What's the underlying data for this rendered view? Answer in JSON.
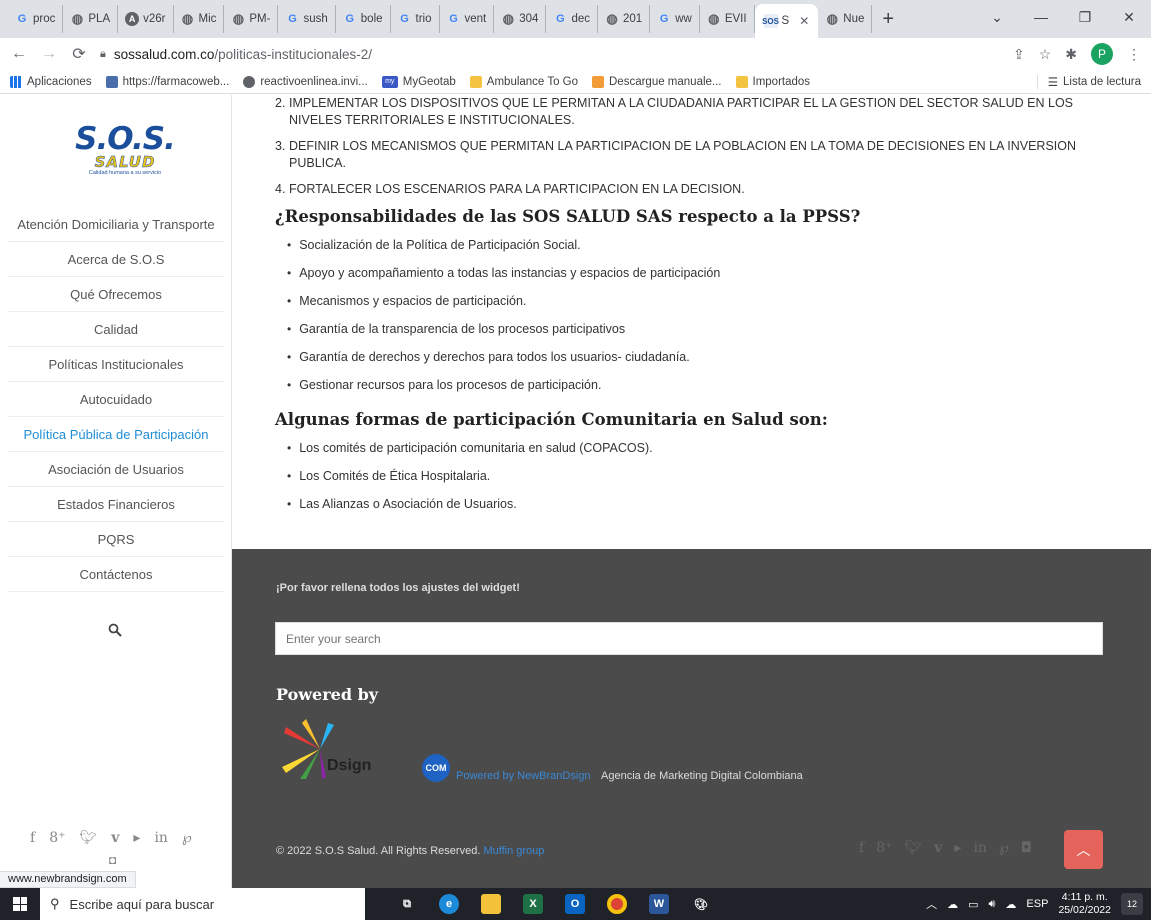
{
  "browser": {
    "tabs": [
      {
        "label": "proc",
        "favicon": "G"
      },
      {
        "label": "PLA",
        "favicon": "globe"
      },
      {
        "label": "v26r",
        "favicon": "A"
      },
      {
        "label": "Mic",
        "favicon": "globe"
      },
      {
        "label": "PM-",
        "favicon": "globe"
      },
      {
        "label": "sush",
        "favicon": "G"
      },
      {
        "label": "bole",
        "favicon": "G"
      },
      {
        "label": "trio",
        "favicon": "G"
      },
      {
        "label": "vent",
        "favicon": "G"
      },
      {
        "label": "304",
        "favicon": "globe"
      },
      {
        "label": "dec",
        "favicon": "G"
      },
      {
        "label": "201",
        "favicon": "globe"
      },
      {
        "label": "ww",
        "favicon": "G"
      },
      {
        "label": "EVII",
        "favicon": "globe"
      },
      {
        "label": "S",
        "favicon": "SOS",
        "active": true
      },
      {
        "label": "Nue",
        "favicon": "globe"
      }
    ],
    "url_host": "sossalud.com.co",
    "url_path": "/politicas-institucionales-2/",
    "profile_initial": "P",
    "bookmarks": [
      "Aplicaciones",
      "https://farmacoweb...",
      "reactivoenlinea.invi...",
      "MyGeotab",
      "Ambulance To Go",
      "Descargue manuale...",
      "Importados"
    ],
    "reading_list": "Lista de lectura",
    "status_url": "www.newbrandsign.com"
  },
  "sidebar": {
    "logo": {
      "line1": "S.O.S.",
      "line2": "SALUD",
      "tagline": "Calidad humana a su servicio"
    },
    "menu": [
      {
        "label": "Atención Domiciliaria y Transporte",
        "active": false
      },
      {
        "label": "Acerca de S.O.S",
        "active": false
      },
      {
        "label": "Qué Ofrecemos",
        "active": false
      },
      {
        "label": "Calidad",
        "active": false
      },
      {
        "label": "Políticas Institucionales",
        "active": false
      },
      {
        "label": "Autocuidado",
        "active": false
      },
      {
        "label": "Política Pública de Participación",
        "active": true
      },
      {
        "label": "Asociación de Usuarios",
        "active": false
      },
      {
        "label": "Estados Financieros",
        "active": false
      },
      {
        "label": "PQRS",
        "active": false
      },
      {
        "label": "Contáctenos",
        "active": false
      }
    ]
  },
  "content": {
    "ordered_items": [
      {
        "num": "2.",
        "text": "IMPLEMENTAR LOS DISPOSITIVOS QUE LE PERMITAN A LA CIUDADANIA PARTICIPAR EL LA GESTION DEL SECTOR SALUD EN LOS NIVELES TERRITORIALES E INSTITUCIONALES."
      },
      {
        "num": "3.",
        "text": "DEFINIR LOS MECANISMOS QUE PERMITAN LA PARTICIPACION DE LA POBLACION EN LA TOMA DE DECISIONES EN LA INVERSION PUBLICA."
      },
      {
        "num": "4.",
        "text": "FORTALECER LOS ESCENARIOS PARA LA PARTICIPACION EN LA DECISION."
      }
    ],
    "heading1": "¿Responsabilidades de las SOS SALUD SAS respecto a la PPSS?",
    "bullets1": [
      "Socialización de la Política de Participación Social.",
      "Apoyo y acompañamiento a todas las instancias y espacios de participación",
      "Mecanismos y espacios de participación.",
      "Garantía de la transparencia de los procesos participativos",
      "Garantía de derechos y derechos para todos los usuarios- ciudadanía.",
      "Gestionar recursos para los procesos de participación."
    ],
    "heading2": "Algunas formas de participación Comunitaria en Salud son:",
    "bullets2": [
      "Los comités de participación comunitaria en salud (COPACOS).",
      "Los Comités de Ética Hospitalaria.",
      "Las Alianzas o Asociación de Usuarios."
    ]
  },
  "footer": {
    "widget_warning": "¡Por favor rellena todos los ajustes del widget!",
    "search_placeholder": "Enter your search",
    "powered_title": "Powered by",
    "brand_text": "Dsign",
    "brand_com": "COM",
    "powered_link": "Powered by NewBranDsign",
    "agency_text": "Agencia de Marketing Digital Colombiana",
    "copyright": "© 2022 S.O.S Salud. All Rights Reserved.",
    "copyright_link": "Muffin group",
    "accent_color": "#e4635b",
    "background_color": "#4b4b4b"
  },
  "taskbar": {
    "search_placeholder": "Escribe aquí para buscar",
    "language": "ESP",
    "time": "4:11 p. m.",
    "date": "25/02/2022",
    "notifications": "12"
  }
}
